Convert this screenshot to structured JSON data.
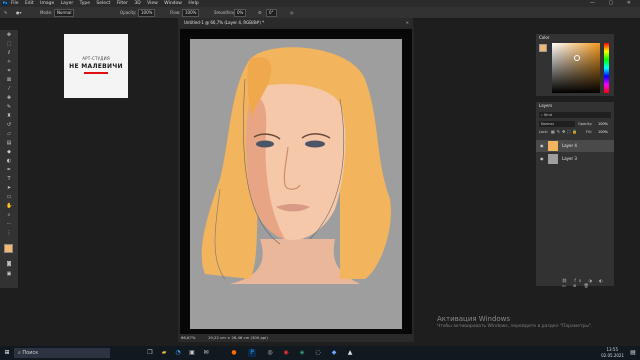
{
  "menubar": {
    "app_badge": "Ps",
    "items": [
      "File",
      "Edit",
      "Image",
      "Layer",
      "Type",
      "Select",
      "Filter",
      "3D",
      "View",
      "Window",
      "Help"
    ],
    "window_controls": "—  ▢  ✕"
  },
  "options_bar": {
    "mode_label": "Mode:",
    "mode_value": "Normal",
    "opacity_label": "Opacity:",
    "opacity_value": "100%",
    "flow_label": "Flow:",
    "flow_value": "100%",
    "smoothing_label": "Smoothing:",
    "smoothing_value": "0%",
    "angle_value": "0°"
  },
  "logo": {
    "subtitle": "АРТ-СТУДИЯ",
    "title": "НЕ МАЛЕВИЧИ"
  },
  "document": {
    "tab_title": "Untitled-1 @ 66,7% (Layer 4, RGB/8#) *",
    "status_zoom": "66,67%",
    "status_size": "19,22 cm × 26,46 cm (300 ppi)"
  },
  "color_panel": {
    "title": "Color"
  },
  "layers_panel": {
    "title": "Layers",
    "filter_kind": "Kind",
    "blend_mode": "Normal",
    "opacity_label": "Opacity:",
    "opacity_value": "100%",
    "lock_label": "Lock:",
    "fill_label": "Fill:",
    "fill_value": "100%",
    "layers": [
      {
        "name": "Layer 4",
        "selected": true
      },
      {
        "name": "Layer 3",
        "selected": false
      }
    ]
  },
  "watermark": {
    "line1": "Активация Windows",
    "line2": "Чтобы активировать Windows, перейдите в раздел \"Параметры\"."
  },
  "taskbar": {
    "search_placeholder": "Поиск",
    "time": "13:55",
    "date": "02.05.2021"
  },
  "colors": {
    "hair": "#f2b45c",
    "skin": "#f4c8a8",
    "canvas_bg": "#9e9e9e",
    "accent_red": "#dd1111"
  }
}
